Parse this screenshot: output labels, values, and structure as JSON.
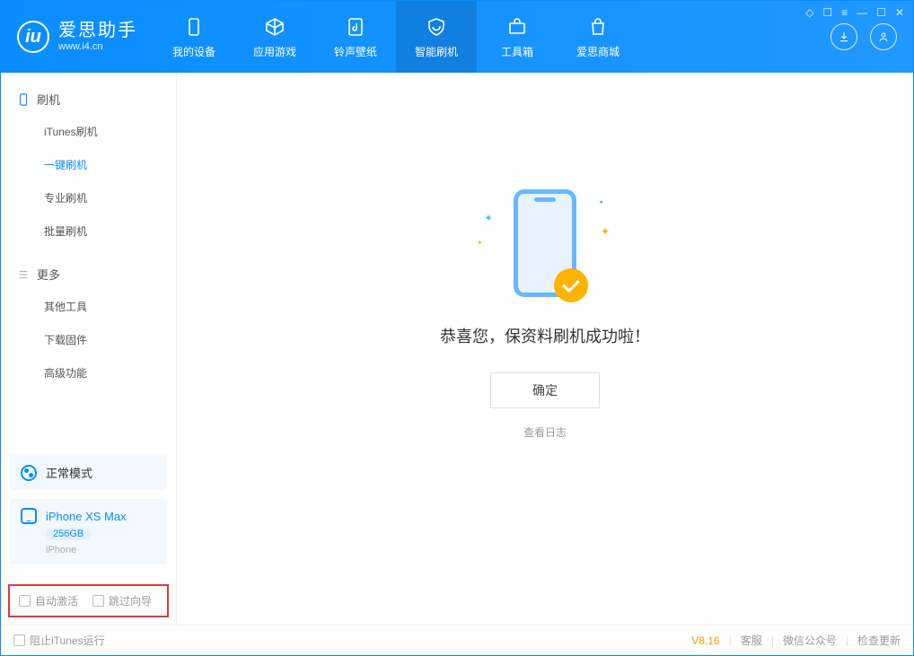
{
  "app": {
    "name": "爱思助手",
    "url": "www.i4.cn"
  },
  "header_tabs": [
    {
      "label": "我的设备"
    },
    {
      "label": "应用游戏"
    },
    {
      "label": "铃声壁纸"
    },
    {
      "label": "智能刷机"
    },
    {
      "label": "工具箱"
    },
    {
      "label": "爱思商城"
    }
  ],
  "sidebar": {
    "section_flash": "刷机",
    "items_flash": [
      "iTunes刷机",
      "一键刷机",
      "专业刷机",
      "批量刷机"
    ],
    "section_more": "更多",
    "items_more": [
      "其他工具",
      "下载固件",
      "高级功能"
    ]
  },
  "mode": {
    "label": "正常模式"
  },
  "device": {
    "name": "iPhone XS Max",
    "storage": "256GB",
    "type": "iPhone"
  },
  "checks": {
    "auto_activate": "自动激活",
    "skip_guide": "跳过向导"
  },
  "main": {
    "success_text": "恭喜您，保资料刷机成功啦！",
    "ok_button": "确定",
    "log_link": "查看日志"
  },
  "status": {
    "stop_itunes": "阻止iTunes运行",
    "version": "V8.16",
    "support": "客服",
    "wechat": "微信公众号",
    "check_update": "检查更新"
  }
}
